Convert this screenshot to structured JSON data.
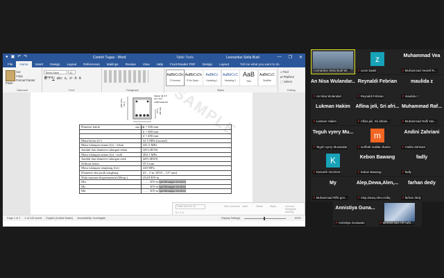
{
  "word": {
    "doc_title": "Contoh Tugas - Word",
    "table_tools": "Table Tools",
    "user": "Leonardus Setia Budi",
    "tabs": [
      "File",
      "Home",
      "Insert",
      "Design",
      "Layout",
      "References",
      "Mailings",
      "Review",
      "View",
      "Help",
      "Foxit Reader PDF",
      "Design",
      "Layout"
    ],
    "tell_me": "Tell me what you want to do",
    "clipboard": {
      "paste": "Paste",
      "cut": "Cut",
      "copy": "Copy",
      "format_painter": "Format Painter",
      "label": "Clipboard"
    },
    "font": {
      "name": "Times New Roma",
      "size": "12",
      "label": "Font",
      "format_buttons": [
        "B",
        "I",
        "U",
        "abc",
        "x₂",
        "x²",
        "A",
        "A"
      ]
    },
    "paragraph_label": "Paragraph",
    "styles": [
      {
        "preview": "AaBbCcDc",
        "name": "¶ Normal"
      },
      {
        "preview": "AaBbCcDc",
        "name": "¶ No Spac..."
      },
      {
        "preview": "AaBbCc",
        "name": "Heading 1"
      },
      {
        "preview": "AaBbCcC",
        "name": "Heading 2"
      },
      {
        "preview": "AaB",
        "name": "Title"
      },
      {
        "preview": "AaBbCcC",
        "name": "Subtitle"
      }
    ],
    "styles_label": "Styles",
    "editing": {
      "find": "Find",
      "replace": "Replace",
      "select": "Select",
      "label": "Editing"
    },
    "figure": {
      "spacer": "Spacer @ 2.5",
      "spacer2": "(2.2 mm)",
      "stirrup": "4 Ø8 Grade 60",
      "dim_width": "11.8 in.",
      "dim_width2": "(300 mm)",
      "dim_height": "18 in.",
      "dim_height2": "(460 mm)",
      "dim_side": "16 in.",
      "dim_side2": "(60 mm)"
    },
    "table_rows": [
      {
        "label": "Dimensi balok",
        "value": "b = 300 mm"
      },
      {
        "label": "",
        "value": "h = 460 mm"
      },
      {
        "label": "",
        "value": "d = 400 mm"
      },
      {
        "label": "Mutu beton (fc')",
        "value": "32.5 MPa (normal)"
      },
      {
        "label": "Mutu tulangan utama (fy) - tekan",
        "value": "441.5 MPa"
      },
      {
        "label": "Jumlah dan diameter tulangan tekan",
        "value": "2#5 (2D16)"
      },
      {
        "label": "Mutu tulangan utama (fy) - tarik",
        "value": "484.1 MPa"
      },
      {
        "label": "Jumlah dan diameter tulangan tarik",
        "value": "4#9 (4D29)"
      },
      {
        "label": "Selimut beton",
        "value": "35.5 mm"
      },
      {
        "label": "Mutu tulangan sengkang (fyt)",
        "value": "420 MPa"
      },
      {
        "label": "Diameter dan jarak sengkang",
        "value": "#3 – 5 in. (D10 – 127 mm)"
      },
      {
        "label": "Nilai momen eksperimental (Mexp.)",
        "value": "434.8 KN-m"
      },
      {
        "label": "Mcr",
        "value": "…… KN-m",
        "value_hl": "(perhitungan teoritis)"
      },
      {
        "label": "My",
        "value": "…… KN-m",
        "value_hl": "(perhitungan teoritis)"
      },
      {
        "label": "Mn",
        "value": "…… KN-m",
        "value_hl": "(perhitungan teoritis)"
      }
    ],
    "watermark": "SAMPLE",
    "mini_toolbar": {
      "font": "Times New Ro",
      "size": "12",
      "items": [
        "Insert",
        "Delete",
        "Styles",
        "Line and Paragraph Spacing"
      ],
      "new_comment": "New Comment"
    },
    "status": {
      "page": "Page 1 of 1",
      "words": "2 of 143 words",
      "language": "English (United States)",
      "accessibility": "Accessibility: Investigate",
      "display": "Display Settings",
      "zoom": "100%"
    }
  },
  "participants": [
    {
      "name": "Leonardus Setia Budi Wi...",
      "type": "photo",
      "active": true,
      "muted": false
    },
    {
      "name": "zoom baal4",
      "type": "avatar",
      "initial": "z",
      "color": "#17a2b8",
      "muted": true
    },
    {
      "name": "Muhammad Vearell R...",
      "type": "text",
      "big": "Muhammad Vea",
      "muted": true
    },
    {
      "name": "An Nisa Wulandari",
      "type": "text",
      "big": "An Nisa Wulandar...",
      "muted": true
    },
    {
      "name": "Reynaldi Febrian",
      "type": "text",
      "big": "Reynaldi Febrian",
      "muted": true
    },
    {
      "name": "maulida z",
      "type": "text",
      "big": "maulida z",
      "muted": true
    },
    {
      "name": "Lukman Hakim",
      "type": "text",
      "big": "Lukman Hakim",
      "muted": true
    },
    {
      "name": "Aflina jeli, Sri afriani...",
      "type": "text",
      "big": "Aflina jeli, Sri afri...",
      "muted": true
    },
    {
      "name": "Muhammad Rafli Yan...",
      "type": "text",
      "big": "Muhammad Raf...",
      "muted": true
    },
    {
      "name": "Teguh vyery Munandar",
      "type": "text",
      "big": "Teguh vyery Mu...",
      "muted": true
    },
    {
      "name": "nurfitah malida chania",
      "type": "avatar",
      "initial": "m",
      "color": "#f26522",
      "muted": true
    },
    {
      "name": "Andini Zahriani",
      "type": "text",
      "big": "Andini Zahriani",
      "muted": true
    },
    {
      "name": "Kenneth Vinchent",
      "type": "avatar",
      "initial": "K",
      "color": "#17a2b8",
      "muted": true
    },
    {
      "name": "Kebon Bawang",
      "type": "text",
      "big": "Kebon Bawang",
      "muted": true
    },
    {
      "name": "fadly",
      "type": "text",
      "big": "fadly",
      "muted": true
    },
    {
      "name": "Muhammad Rifki gen...",
      "type": "text",
      "big": "My",
      "muted": true
    },
    {
      "name": "Alep,Dewa,Alen,Hafiq",
      "type": "text",
      "big": "Alep,Dewa,Alen,...",
      "muted": true
    },
    {
      "name": "farhan dedy",
      "type": "text",
      "big": "farhan dedy",
      "muted": true
    },
    {
      "name": "Annistiya Gunawan",
      "type": "text",
      "big": "Annistiya Guna...",
      "muted": true
    },
    {
      "name": "Muhammad Alif Aufa ...",
      "type": "photo2",
      "muted": true
    }
  ]
}
